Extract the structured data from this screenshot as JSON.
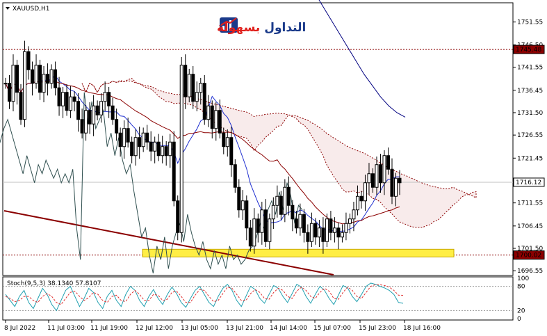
{
  "symbol_title": "XAUUSD,H1",
  "logo": {
    "text_a": "التداول",
    "text_b": "بسهولة",
    "color_a": "#1a3a8a",
    "color_b": "#e0201c"
  },
  "colors": {
    "up_candle": "#000000",
    "down_candle": "#000000",
    "tenkan": "#1f2fd0",
    "kijun": "#8b0000",
    "chikou": "#2f4f4f",
    "kumo_a": "#8b0000",
    "kumo_b": "#2e8b2e",
    "ma": "#000080",
    "trendline": "#8b0000",
    "highlight": "#ffee44",
    "stoch_main": "#20a0b0",
    "stoch_signal": "#e03030"
  },
  "chart_data": {
    "type": "candlestick",
    "y_ticks": [
      "1751.55",
      "1746.50",
      "1741.55",
      "1736.45",
      "1731.50",
      "1726.55",
      "1721.45",
      "1716.50",
      "1711.55",
      "1706.45",
      "1701.50",
      "1696.55"
    ],
    "ylim": [
      1695.5,
      1755.8
    ],
    "x_ticks": [
      "8 Jul 2022",
      "11 Jul 03:00",
      "11 Jul 19:00",
      "12 Jul 12:00",
      "13 Jul 05:00",
      "13 Jul 21:00",
      "14 Jul 14:00",
      "15 Jul 07:00",
      "15 Jul 23:00",
      "18 Jul 16:00"
    ],
    "price_labels": [
      {
        "text": "1745.48",
        "value": 1745.48,
        "style": "level"
      },
      {
        "text": "1716.12",
        "value": 1716.12,
        "style": "current"
      },
      {
        "text": "1700.02",
        "value": 1700.02,
        "style": "level"
      }
    ],
    "horizontal_levels": [
      1745.48,
      1700.02
    ],
    "highlight_zone": {
      "from": 1699.6,
      "to": 1701.3
    },
    "closes": [
      1738,
      1734,
      1742,
      1736,
      1730,
      1745,
      1741,
      1738,
      1742,
      1736,
      1740,
      1738,
      1741,
      1737,
      1733,
      1736,
      1732,
      1735,
      1734,
      1730,
      1727,
      1732,
      1729,
      1733,
      1731,
      1734,
      1736,
      1733,
      1730,
      1727,
      1724,
      1728,
      1725,
      1722,
      1726,
      1724,
      1727,
      1725,
      1723,
      1725,
      1722,
      1724,
      1722,
      1725,
      1712,
      1705,
      1742,
      1735,
      1740,
      1734,
      1736,
      1738,
      1730,
      1733,
      1728,
      1732,
      1727,
      1724,
      1726,
      1720,
      1715,
      1710,
      1712,
      1706,
      1702,
      1708,
      1705,
      1710,
      1703,
      1708,
      1711,
      1713,
      1709,
      1715,
      1711,
      1708,
      1706,
      1709,
      1705,
      1703,
      1707,
      1704,
      1706,
      1703,
      1708,
      1705,
      1706,
      1704,
      1705,
      1707,
      1708,
      1710,
      1713,
      1712,
      1716,
      1718,
      1715,
      1720,
      1716,
      1722,
      1719,
      1713,
      1717,
      1716
    ],
    "ma_values": [
      1779,
      1776,
      1773,
      1770,
      1767,
      1764,
      1761,
      1758,
      1755,
      1752,
      1749,
      1746,
      1743,
      1740,
      1737.5,
      1735,
      1733,
      1731.5,
      1730.5
    ],
    "stochastic": {
      "label": "Stoch(9,5,3) 38.1340 57.8107",
      "main": 38.134,
      "signal": 57.8107,
      "levels": [
        80,
        20
      ],
      "ticks": [
        "100",
        "80",
        "20",
        "0"
      ],
      "main_series": [
        60,
        45,
        30,
        55,
        70,
        40,
        25,
        50,
        75,
        60,
        35,
        20,
        45,
        70,
        80,
        55,
        30,
        50,
        75,
        65,
        40,
        25,
        55,
        70,
        45,
        30,
        60,
        80,
        70,
        45,
        30,
        55,
        72,
        50,
        35,
        60,
        78,
        62,
        40,
        28,
        50,
        70,
        80,
        60,
        40,
        30,
        55,
        75,
        85,
        70,
        45,
        30,
        55,
        80,
        72,
        50,
        38,
        60,
        82,
        75,
        55,
        40,
        62,
        85,
        78,
        55,
        38,
        60,
        80,
        70,
        50,
        35,
        58,
        82,
        76,
        55,
        42,
        60,
        80,
        88,
        85,
        80,
        76,
        70,
        60,
        40,
        38
      ],
      "signal_series": [
        55,
        50,
        42,
        45,
        55,
        55,
        45,
        40,
        55,
        62,
        55,
        40,
        35,
        50,
        65,
        68,
        55,
        45,
        52,
        65,
        60,
        45,
        40,
        55,
        58,
        45,
        42,
        60,
        70,
        60,
        45,
        45,
        60,
        58,
        45,
        48,
        65,
        68,
        55,
        40,
        40,
        58,
        72,
        70,
        55,
        42,
        45,
        62,
        78,
        75,
        60,
        45,
        45,
        62,
        72,
        65,
        50,
        48,
        65,
        75,
        70,
        55,
        50,
        68,
        78,
        70,
        55,
        50,
        65,
        75,
        68,
        50,
        48,
        65,
        78,
        70,
        55,
        50,
        65,
        80,
        84,
        84,
        82,
        78,
        70,
        58,
        57.8
      ]
    }
  }
}
